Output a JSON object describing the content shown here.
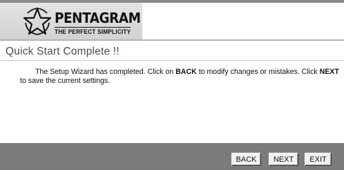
{
  "brand": {
    "name": "PENTAGRAM",
    "tagline": "THE PERFECT SIMPLICITY"
  },
  "page": {
    "title": "Quick Start Complete !!"
  },
  "message": {
    "part1": "The Setup Wizard has completed. Click on ",
    "back_word": "BACK",
    "part2": " to modify changes or mistakes. Click ",
    "next_word": "NEXT",
    "part3": "to save the current settings."
  },
  "buttons": {
    "back": "BACK",
    "next": "NEXT",
    "exit": "EXIT"
  },
  "colors": {
    "header_bar": "#8a8a8a",
    "footer": "#7b7b7b",
    "logo_bg": "#d8d8d8"
  }
}
